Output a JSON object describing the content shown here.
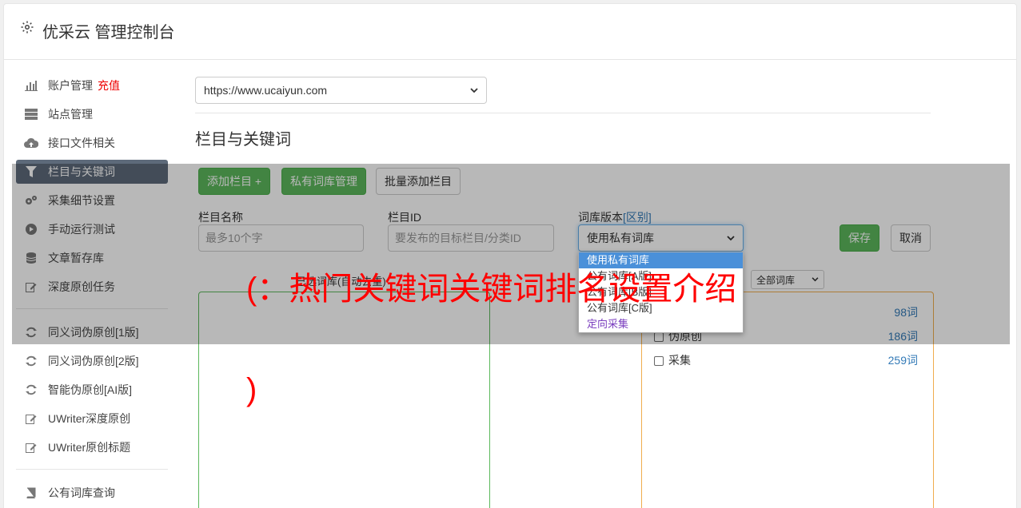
{
  "app": {
    "title": "优采云 管理控制台"
  },
  "sidebar": {
    "items": [
      {
        "label": "账户管理",
        "extra": "充值",
        "icon": "bar-chart-icon"
      },
      {
        "label": "站点管理",
        "icon": "server-icon"
      },
      {
        "label": "接口文件相关",
        "icon": "cloud-upload-icon"
      },
      {
        "label": "栏目与关键词",
        "icon": "filter-icon",
        "active": true
      },
      {
        "label": "采集细节设置",
        "icon": "cogs-icon"
      },
      {
        "label": "手动运行测试",
        "icon": "play-circle-icon"
      },
      {
        "label": "文章暂存库",
        "icon": "database-icon"
      },
      {
        "label": "深度原创任务",
        "icon": "edit-icon"
      }
    ],
    "items2": [
      {
        "label": "同义词伪原创[1版]",
        "icon": "refresh-icon"
      },
      {
        "label": "同义词伪原创[2版]",
        "icon": "refresh-icon"
      },
      {
        "label": "智能伪原创[AI版]",
        "icon": "refresh-icon"
      },
      {
        "label": "UWriter深度原创",
        "icon": "edit-icon"
      },
      {
        "label": "UWriter原创标题",
        "icon": "edit-icon"
      }
    ],
    "items3": [
      {
        "label": "公有词库查询",
        "icon": "book-icon"
      }
    ]
  },
  "main": {
    "site_select": "https://www.ucaiyun.com",
    "section_title": "栏目与关键词",
    "buttons": {
      "add_column": "添加栏目 +",
      "private_lib": "私有词库管理",
      "batch_add": "批量添加栏目",
      "save": "保存",
      "cancel": "取消"
    },
    "form": {
      "name_label": "栏目名称",
      "name_placeholder": "最多10个字",
      "id_label": "栏目ID",
      "id_placeholder": "要发布的目标栏目/分类ID",
      "version_label": "词库版本",
      "version_link": "[区别]",
      "version_value": "使用私有词库"
    },
    "dropdown_options": [
      "使用私有词库",
      "公有词库[A版]",
      "公有词库[B版]",
      "公有词库[C版]",
      "定向采集"
    ],
    "panel_left_label": "已选词库(自动去重)",
    "filter_select": "全部词库",
    "libraries": [
      {
        "name": "",
        "count": "98词"
      },
      {
        "name": "伪原创",
        "count": "186词"
      },
      {
        "name": "采集",
        "count": "259词"
      }
    ]
  },
  "caption": {
    "line1": "(：热门关键词关键词排名设置介绍",
    "line2": ")"
  },
  "colors": {
    "green": "#5cb85c",
    "orange": "#f0ad4e",
    "active_nav": "#5d6a7a",
    "caption": "#ff0000"
  }
}
